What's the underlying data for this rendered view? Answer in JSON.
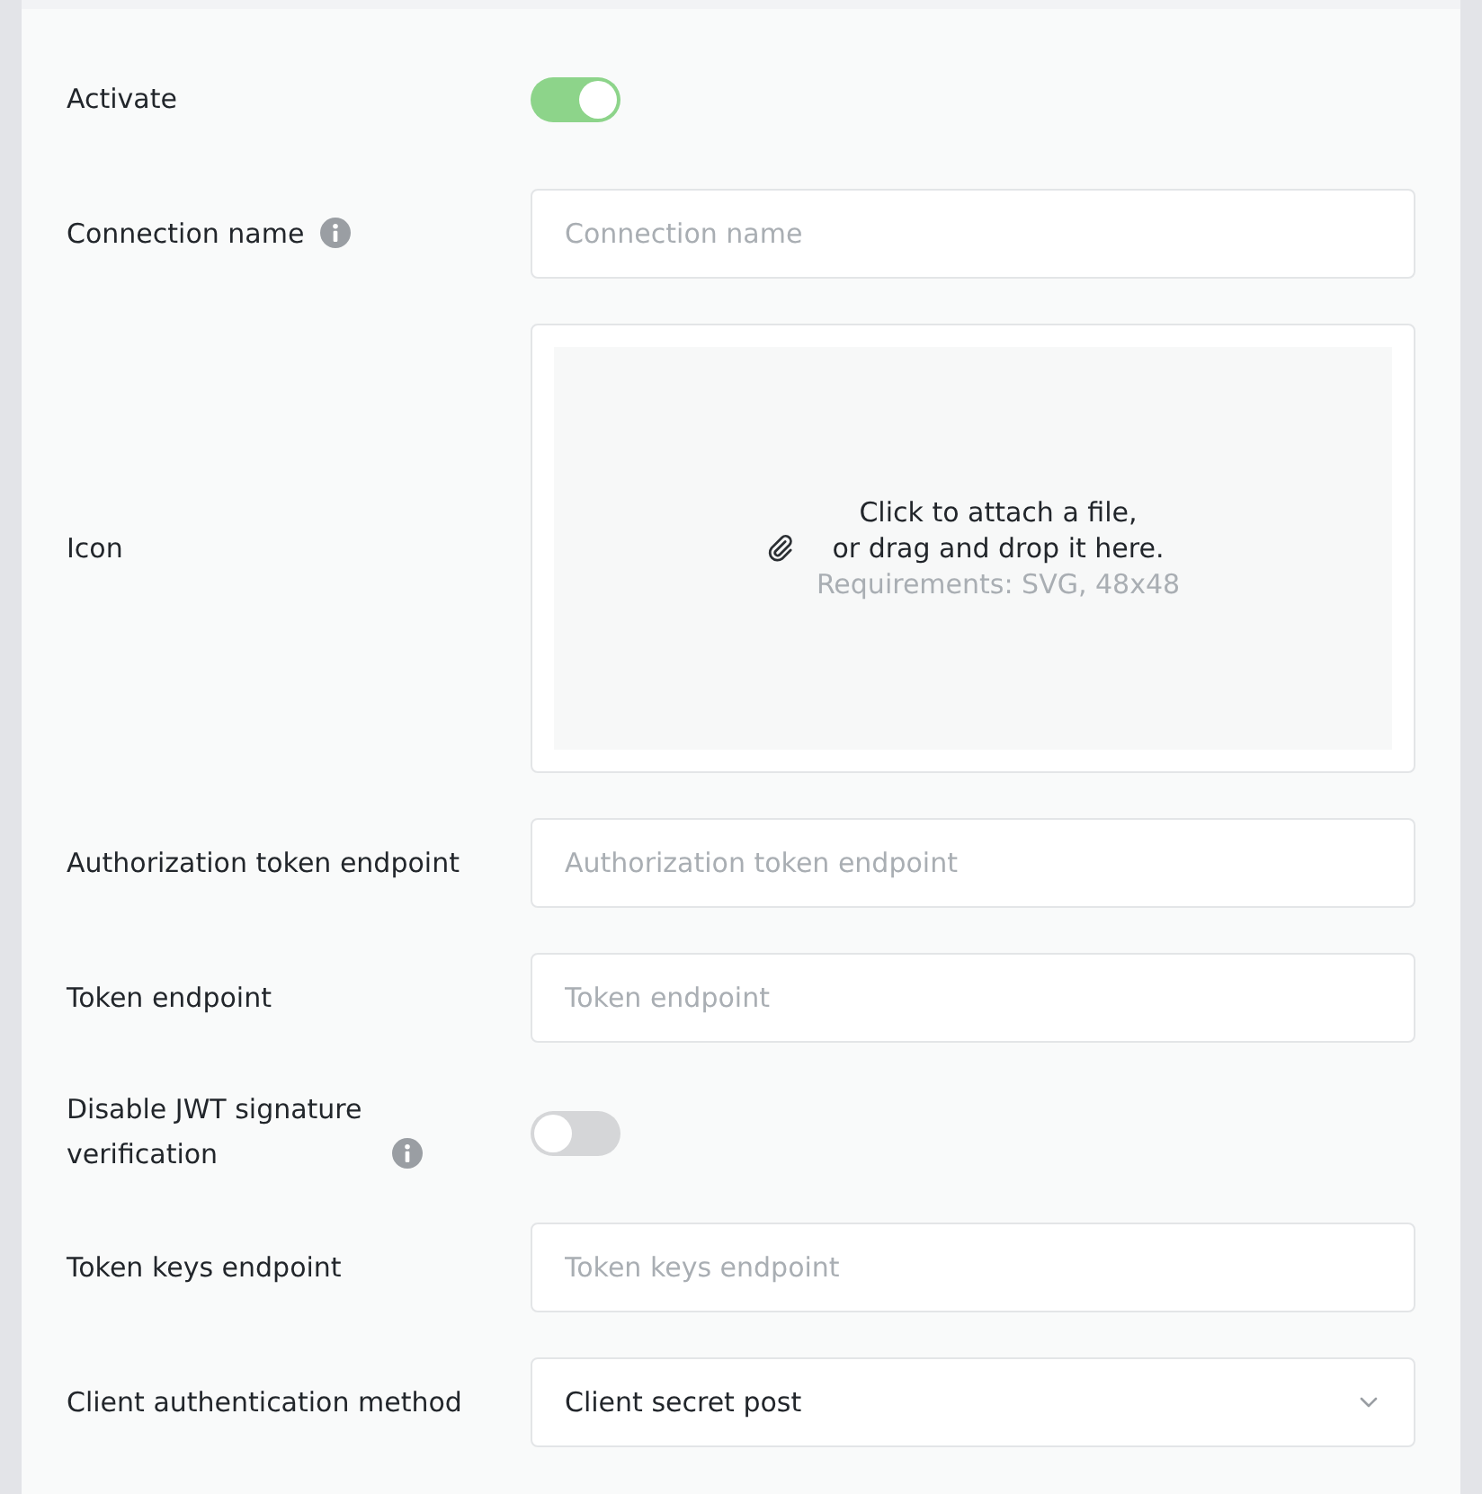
{
  "fields": [
    {
      "kind": "toggle",
      "label": "Activate",
      "info": false,
      "on": true
    },
    {
      "kind": "text",
      "label": "Connection name",
      "info": true,
      "placeholder": "Connection name"
    },
    {
      "kind": "upload",
      "label": "Icon",
      "info": false,
      "prompt": "Click to attach a file,\nor drag and drop it here.",
      "requirements": "Requirements: SVG, 48x48"
    },
    {
      "kind": "text",
      "label": "Authorization token endpoint",
      "info": false,
      "placeholder": "Authorization token endpoint"
    },
    {
      "kind": "text",
      "label": "Token endpoint",
      "info": false,
      "placeholder": "Token endpoint"
    },
    {
      "kind": "toggle",
      "label": "Disable JWT signature verification",
      "info": true,
      "on": false
    },
    {
      "kind": "text",
      "label": "Token keys endpoint",
      "info": false,
      "placeholder": "Token keys endpoint"
    },
    {
      "kind": "select",
      "label": "Client authentication method",
      "info": false,
      "value": "Client secret post"
    }
  ]
}
